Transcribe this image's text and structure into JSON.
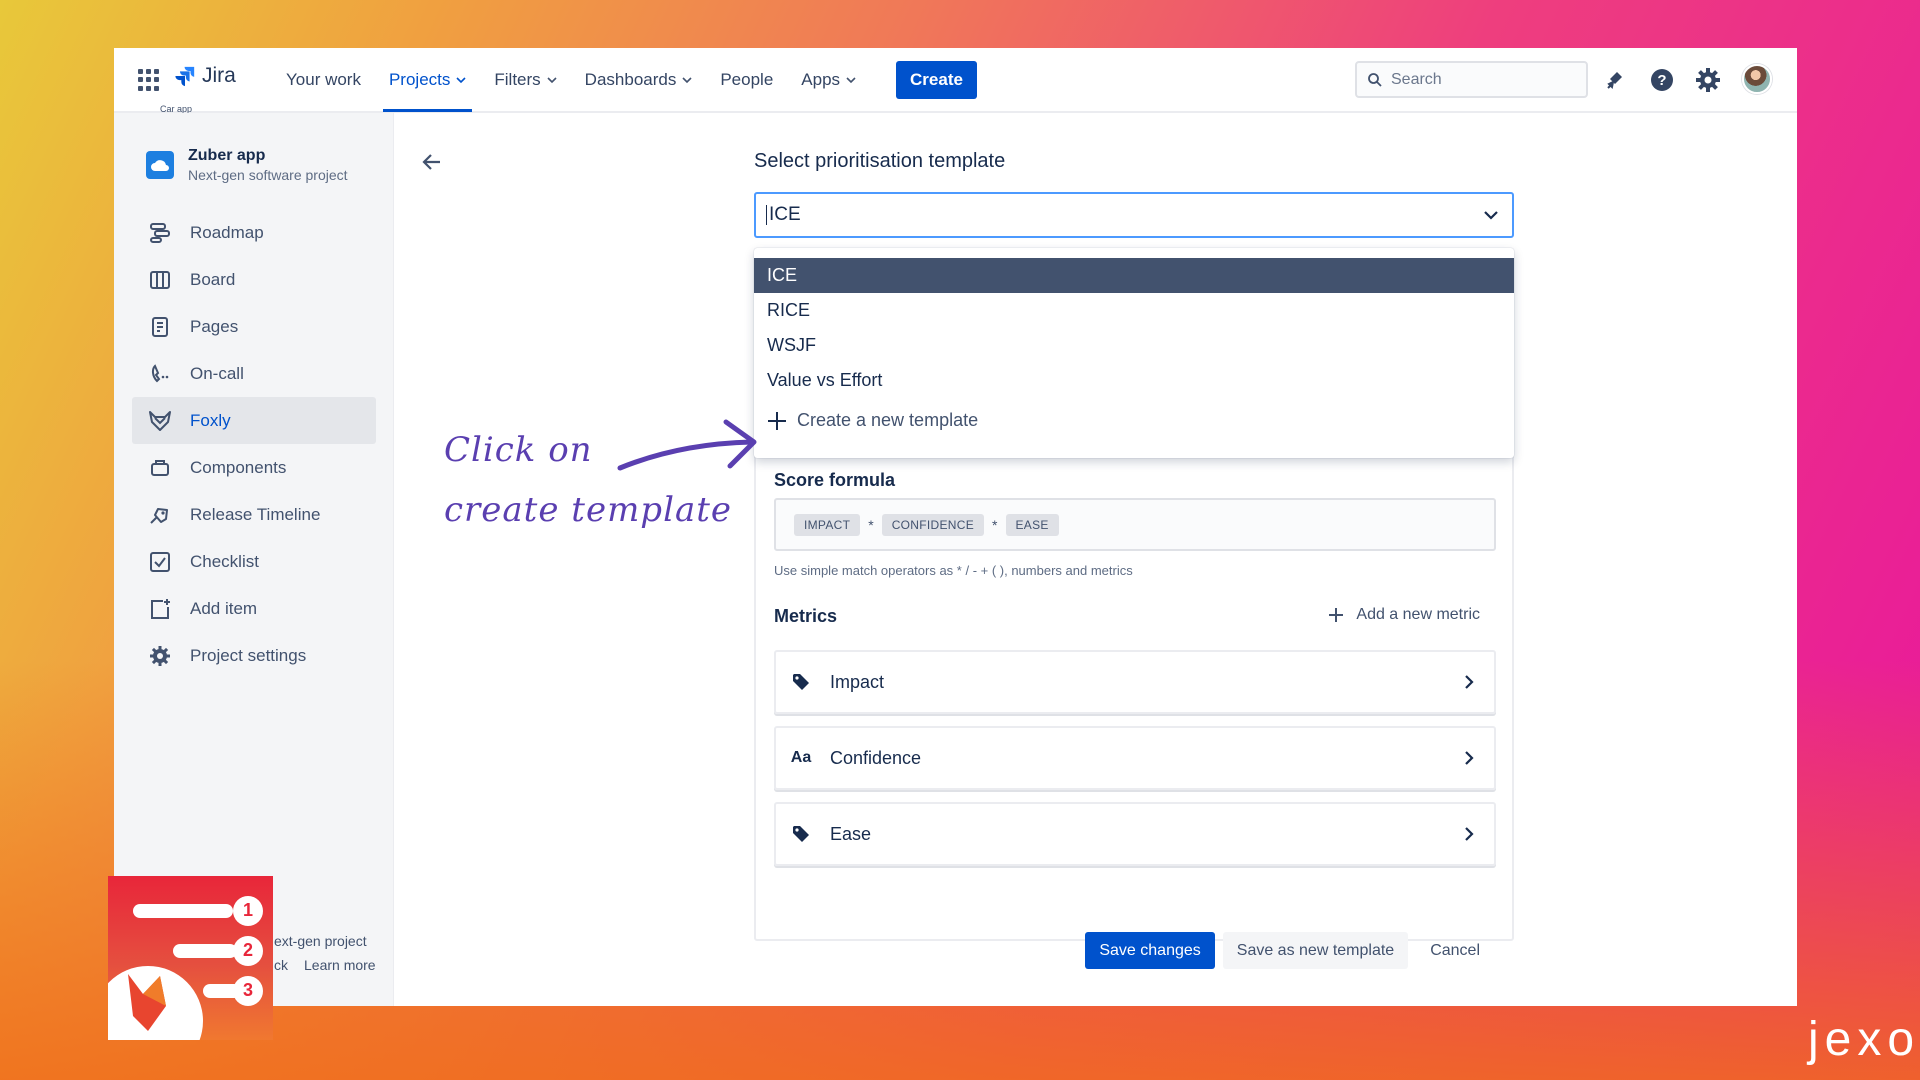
{
  "topnav": {
    "app_name": "Jira",
    "app_caption": "Car app",
    "items": [
      {
        "label": "Your work",
        "active": false,
        "dropdown": false
      },
      {
        "label": "Projects",
        "active": true,
        "dropdown": true
      },
      {
        "label": "Filters",
        "active": false,
        "dropdown": true
      },
      {
        "label": "Dashboards",
        "active": false,
        "dropdown": true
      },
      {
        "label": "People",
        "active": false,
        "dropdown": false
      },
      {
        "label": "Apps",
        "active": false,
        "dropdown": true
      }
    ],
    "create_label": "Create",
    "search_placeholder": "Search",
    "icons": [
      "notifications-icon",
      "help-icon",
      "settings-icon"
    ]
  },
  "sidebar": {
    "project_name": "Zuber app",
    "project_type": "Next-gen software project",
    "items": [
      {
        "label": "Roadmap",
        "icon": "roadmap-icon",
        "active": false
      },
      {
        "label": "Board",
        "icon": "board-icon",
        "active": false
      },
      {
        "label": "Pages",
        "icon": "pages-icon",
        "active": false
      },
      {
        "label": "On-call",
        "icon": "on-call-icon",
        "active": false
      },
      {
        "label": "Foxly",
        "icon": "foxly-icon",
        "active": true
      },
      {
        "label": "Components",
        "icon": "components-icon",
        "active": false
      },
      {
        "label": "Release Timeline",
        "icon": "release-timeline-icon",
        "active": false
      },
      {
        "label": "Checklist",
        "icon": "checklist-icon",
        "active": false
      },
      {
        "label": "Add item",
        "icon": "add-item-icon",
        "active": false
      },
      {
        "label": "Project settings",
        "icon": "project-settings-icon",
        "active": false
      }
    ],
    "footer_line1": "ext-gen project",
    "footer_feedback": "ck",
    "footer_learn": "Learn more"
  },
  "main": {
    "title": "Select prioritisation template",
    "selected_template": "ICE",
    "dropdown_options": [
      "ICE",
      "RICE",
      "WSJF",
      "Value vs Effort"
    ],
    "create_template_label": "Create a new template",
    "score_formula_label": "Score formula",
    "formula_tokens": [
      "IMPACT",
      "*",
      "CONFIDENCE",
      "*",
      "EASE"
    ],
    "formula_help": "Use simple match operators as * / - + ( ), numbers and metrics",
    "metrics_label": "Metrics",
    "add_metric_label": "Add a new metric",
    "metrics": [
      {
        "label": "Impact",
        "icon": "tag-icon"
      },
      {
        "label": "Confidence",
        "icon": "text-icon",
        "icon_text": "Aa"
      },
      {
        "label": "Ease",
        "icon": "tag-icon"
      }
    ],
    "save_label": "Save changes",
    "save_new_label": "Save as new template",
    "cancel_label": "Cancel"
  },
  "annotation": {
    "line1": "Click on",
    "line2": "create template"
  },
  "brand": {
    "jexo": "jexo",
    "badge_numbers": [
      "1",
      "2",
      "3"
    ]
  },
  "colors": {
    "accent": "#0052cc",
    "selected_option": "#42526e",
    "annotation": "#5a3fb0"
  }
}
